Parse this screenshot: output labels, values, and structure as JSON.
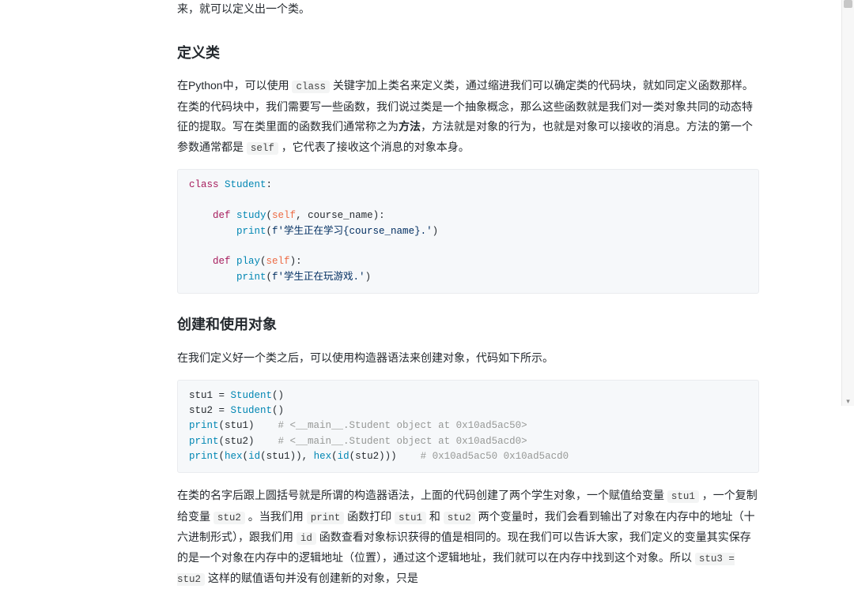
{
  "truncated_top": "来，就可以定义出一个类。",
  "section1": {
    "heading": "定义类",
    "para_parts": {
      "t1": "在Python中，可以使用 ",
      "c1": "class",
      "t2": " 关键字加上类名来定义类，通过缩进我们可以确定类的代码块，就如同定义函数那样。在类的代码块中，我们需要写一些函数，我们说过类是一个抽象概念，那么这些函数就是我们对一类对象共同的动态特征的提取。写在类里面的函数我们通常称之为",
      "b1": "方法",
      "t3": "，方法就是对象的行为，也就是对象可以接收的消息。方法的第一个参数通常都是 ",
      "c2": "self",
      "t4": " ，它代表了接收这个消息的对象本身。"
    },
    "code": {
      "l1a": "class",
      "l1b": " Student",
      "l1c": ":",
      "l2": "",
      "l3a": "    def",
      "l3b": " study",
      "l3c": "(",
      "l3d": "self",
      "l3e": ", course_name):",
      "l4a": "        print",
      "l4b": "(",
      "l4c": "f'学生正在学习{course_name}.'",
      "l4d": ")",
      "l5": "",
      "l6a": "    def",
      "l6b": " play",
      "l6c": "(",
      "l6d": "self",
      "l6e": "):",
      "l7a": "        print",
      "l7b": "(",
      "l7c": "f'学生正在玩游戏.'",
      "l7d": ")"
    }
  },
  "section2": {
    "heading": "创建和使用对象",
    "para1": "在我们定义好一个类之后，可以使用构造器语法来创建对象，代码如下所示。",
    "code": {
      "l1a": "stu1 = ",
      "l1b": "Student",
      "l1c": "()",
      "l2a": "stu2 = ",
      "l2b": "Student",
      "l2c": "()",
      "l3a": "print",
      "l3b": "(stu1)    ",
      "l3c": "# <__main__.Student object at 0x10ad5ac50>",
      "l4a": "print",
      "l4b": "(stu2)    ",
      "l4c": "# <__main__.Student object at 0x10ad5acd0>",
      "l5a": "print",
      "l5b": "(",
      "l5c": "hex",
      "l5d": "(",
      "l5e": "id",
      "l5f": "(stu1)), ",
      "l5g": "hex",
      "l5h": "(",
      "l5i": "id",
      "l5j": "(stu2)))    ",
      "l5k": "# 0x10ad5ac50 0x10ad5acd0"
    },
    "para2_parts": {
      "t1": "在类的名字后跟上圆括号就是所谓的构造器语法，上面的代码创建了两个学生对象，一个赋值给变量 ",
      "c1": "stu1",
      "t2": " ，一个复制给变量 ",
      "c2": "stu2",
      "t3": " 。当我们用 ",
      "c3": "print",
      "t4": " 函数打印 ",
      "c4": "stu1",
      "t5": " 和 ",
      "c5": "stu2",
      "t6": " 两个变量时，我们会看到输出了对象在内存中的地址（十六进制形式），跟我们用 ",
      "c6": "id",
      "t7": " 函数查看对象标识获得的值是相同的。现在我们可以告诉大家，我们定义的变量其实保存的是一个对象在内存中的逻辑地址（位置），通过这个逻辑地址，我们就可以在内存中找到这个对象。所以 ",
      "c7": "stu3 = stu2",
      "t8": " 这样的赋值语句并没有创建新的对象，只是"
    }
  }
}
